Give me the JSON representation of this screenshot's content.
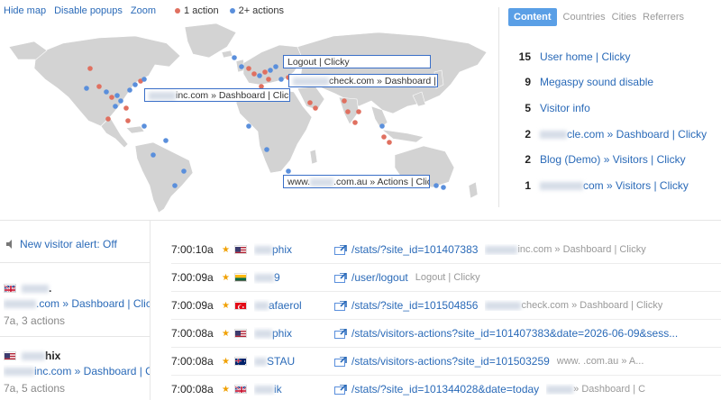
{
  "map_controls": {
    "hide_map": "Hide map",
    "disable_popups": "Disable popups",
    "zoom": "Zoom",
    "legend_single": "1 action",
    "legend_multi": "2+ actions",
    "colors": {
      "single": "#e07060",
      "multi": "#5a8fdc",
      "land": "#d3d3d3"
    }
  },
  "map_popups": [
    {
      "text": "Logout | Clicky"
    },
    {
      "text": "check.com » Dashboard | C"
    },
    {
      "text": "inc.com » Dashboard | Clicky"
    },
    {
      "prefix": "www.",
      "text": ".com.au » Actions | Clicl"
    }
  ],
  "right_panel": {
    "tabs": [
      "Content",
      "Countries",
      "Cities",
      "Referrers"
    ],
    "top_content": [
      {
        "count": "15",
        "label": "User home | Clicky"
      },
      {
        "count": "9",
        "label": "Megaspy sound disable"
      },
      {
        "count": "5",
        "label": "Visitor info"
      },
      {
        "count": "2",
        "label": "cle.com » Dashboard | Clicky"
      },
      {
        "count": "2",
        "label": "Blog (Demo) » Visitors | Clicky"
      },
      {
        "count": "1",
        "label": "com » Visitors | Clicky"
      }
    ]
  },
  "sidebar": {
    "alert": "New visitor alert: Off",
    "visitors": [
      {
        "name": "",
        "name_suffix": ".",
        "page": ".com » Dashboard | Click",
        "meta": "7a, 3 actions"
      },
      {
        "name": "hix",
        "name_suffix": "",
        "page": "inc.com » Dashboard | C",
        "meta": "7a, 5 actions"
      }
    ]
  },
  "actions": [
    {
      "time": "7:00:10a",
      "flag": "us",
      "user": "phix",
      "path": "/stats/?site_id=101407383",
      "title": "inc.com » Dashboard | Clicky"
    },
    {
      "time": "7:00:09a",
      "flag": "lt",
      "user": "9",
      "path": "/user/logout",
      "title": "Logout | Clicky"
    },
    {
      "time": "7:00:09a",
      "flag": "tr",
      "user": "afaerol",
      "path": "/stats/?site_id=101504856",
      "title": "check.com » Dashboard | Clicky"
    },
    {
      "time": "7:00:08a",
      "flag": "us",
      "user": "phix",
      "path": "/stats/visitors-actions?site_id=101407383&date=2026-06-09&sess...",
      "title": ""
    },
    {
      "time": "7:00:08a",
      "flag": "au",
      "user": "STAU",
      "path": "/stats/visitors-actions?site_id=101503259",
      "title": "www.      .com.au » A..."
    },
    {
      "time": "7:00:08a",
      "flag": "gb",
      "user": "ik",
      "path": "/stats/?site_id=101344028&date=today",
      "title": "» Dashboard | C"
    }
  ]
}
